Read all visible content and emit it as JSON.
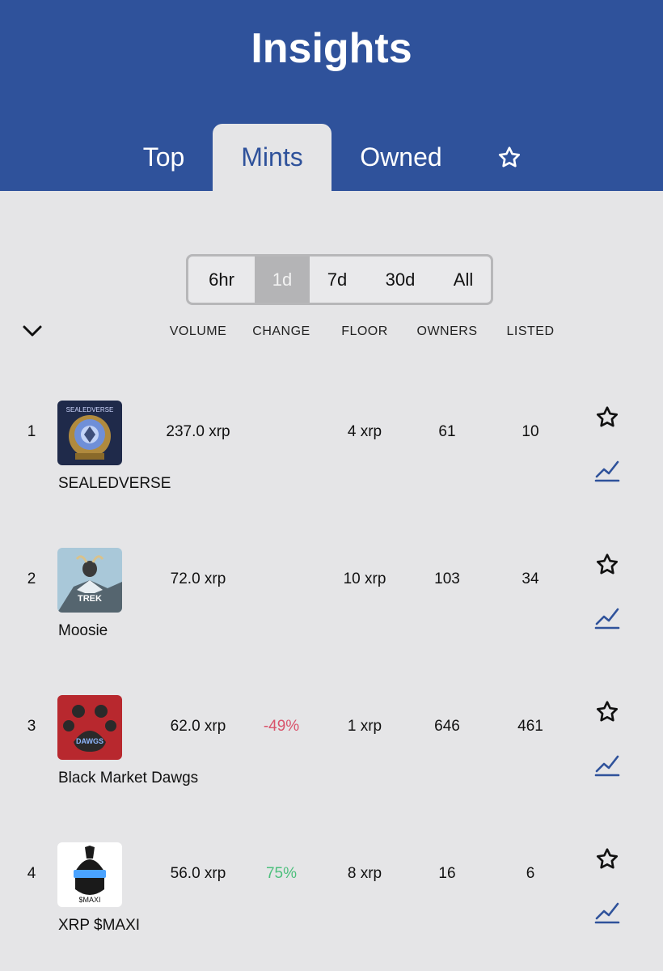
{
  "header": {
    "title": "Insights"
  },
  "tabs": {
    "top": "Top",
    "mints": "Mints",
    "owned": "Owned",
    "favorites_icon": "star-icon"
  },
  "ranges": [
    "6hr",
    "1d",
    "7d",
    "30d",
    "All"
  ],
  "selected_range": "1d",
  "columns": {
    "volume": "VOLUME",
    "change": "CHANGE",
    "floor": "FLOOR",
    "owners": "OWNERS",
    "listed": "LISTED"
  },
  "colors": {
    "header": "#2f529b",
    "negative": "#d9536b",
    "positive": "#4cbf7c",
    "chart_icon": "#2f529b"
  },
  "rows": [
    {
      "rank": "1",
      "name": "SEALEDVERSE",
      "volume": "237.0 xrp",
      "change": "",
      "floor": "4 xrp",
      "owners": "61",
      "listed": "10",
      "thumb_text": "SEALEDVERSE"
    },
    {
      "rank": "2",
      "name": "Moosie",
      "volume": "72.0 xrp",
      "change": "",
      "floor": "10 xrp",
      "owners": "103",
      "listed": "34",
      "thumb_text": "TREK"
    },
    {
      "rank": "3",
      "name": "Black Market Dawgs",
      "volume": "62.0 xrp",
      "change": "-49%",
      "floor": "1 xrp",
      "owners": "646",
      "listed": "461",
      "thumb_text": "DAWGS"
    },
    {
      "rank": "4",
      "name": "XRP $MAXI",
      "volume": "56.0 xrp",
      "change": "75%",
      "floor": "8 xrp",
      "owners": "16",
      "listed": "6",
      "thumb_text": "$MAXI"
    }
  ]
}
